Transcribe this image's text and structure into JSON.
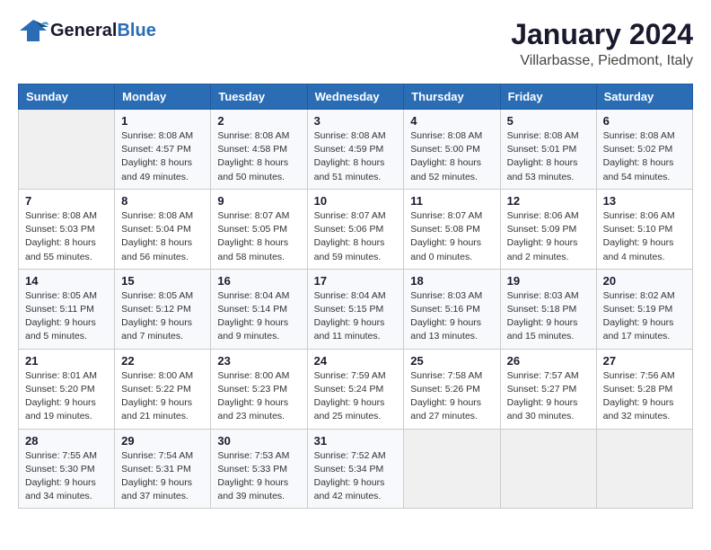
{
  "header": {
    "logo_general": "General",
    "logo_blue": "Blue",
    "month_title": "January 2024",
    "location": "Villarbasse, Piedmont, Italy"
  },
  "days_of_week": [
    "Sunday",
    "Monday",
    "Tuesday",
    "Wednesday",
    "Thursday",
    "Friday",
    "Saturday"
  ],
  "weeks": [
    [
      {
        "day": "",
        "info": ""
      },
      {
        "day": "1",
        "info": "Sunrise: 8:08 AM\nSunset: 4:57 PM\nDaylight: 8 hours\nand 49 minutes."
      },
      {
        "day": "2",
        "info": "Sunrise: 8:08 AM\nSunset: 4:58 PM\nDaylight: 8 hours\nand 50 minutes."
      },
      {
        "day": "3",
        "info": "Sunrise: 8:08 AM\nSunset: 4:59 PM\nDaylight: 8 hours\nand 51 minutes."
      },
      {
        "day": "4",
        "info": "Sunrise: 8:08 AM\nSunset: 5:00 PM\nDaylight: 8 hours\nand 52 minutes."
      },
      {
        "day": "5",
        "info": "Sunrise: 8:08 AM\nSunset: 5:01 PM\nDaylight: 8 hours\nand 53 minutes."
      },
      {
        "day": "6",
        "info": "Sunrise: 8:08 AM\nSunset: 5:02 PM\nDaylight: 8 hours\nand 54 minutes."
      }
    ],
    [
      {
        "day": "7",
        "info": "Sunrise: 8:08 AM\nSunset: 5:03 PM\nDaylight: 8 hours\nand 55 minutes."
      },
      {
        "day": "8",
        "info": "Sunrise: 8:08 AM\nSunset: 5:04 PM\nDaylight: 8 hours\nand 56 minutes."
      },
      {
        "day": "9",
        "info": "Sunrise: 8:07 AM\nSunset: 5:05 PM\nDaylight: 8 hours\nand 58 minutes."
      },
      {
        "day": "10",
        "info": "Sunrise: 8:07 AM\nSunset: 5:06 PM\nDaylight: 8 hours\nand 59 minutes."
      },
      {
        "day": "11",
        "info": "Sunrise: 8:07 AM\nSunset: 5:08 PM\nDaylight: 9 hours\nand 0 minutes."
      },
      {
        "day": "12",
        "info": "Sunrise: 8:06 AM\nSunset: 5:09 PM\nDaylight: 9 hours\nand 2 minutes."
      },
      {
        "day": "13",
        "info": "Sunrise: 8:06 AM\nSunset: 5:10 PM\nDaylight: 9 hours\nand 4 minutes."
      }
    ],
    [
      {
        "day": "14",
        "info": "Sunrise: 8:05 AM\nSunset: 5:11 PM\nDaylight: 9 hours\nand 5 minutes."
      },
      {
        "day": "15",
        "info": "Sunrise: 8:05 AM\nSunset: 5:12 PM\nDaylight: 9 hours\nand 7 minutes."
      },
      {
        "day": "16",
        "info": "Sunrise: 8:04 AM\nSunset: 5:14 PM\nDaylight: 9 hours\nand 9 minutes."
      },
      {
        "day": "17",
        "info": "Sunrise: 8:04 AM\nSunset: 5:15 PM\nDaylight: 9 hours\nand 11 minutes."
      },
      {
        "day": "18",
        "info": "Sunrise: 8:03 AM\nSunset: 5:16 PM\nDaylight: 9 hours\nand 13 minutes."
      },
      {
        "day": "19",
        "info": "Sunrise: 8:03 AM\nSunset: 5:18 PM\nDaylight: 9 hours\nand 15 minutes."
      },
      {
        "day": "20",
        "info": "Sunrise: 8:02 AM\nSunset: 5:19 PM\nDaylight: 9 hours\nand 17 minutes."
      }
    ],
    [
      {
        "day": "21",
        "info": "Sunrise: 8:01 AM\nSunset: 5:20 PM\nDaylight: 9 hours\nand 19 minutes."
      },
      {
        "day": "22",
        "info": "Sunrise: 8:00 AM\nSunset: 5:22 PM\nDaylight: 9 hours\nand 21 minutes."
      },
      {
        "day": "23",
        "info": "Sunrise: 8:00 AM\nSunset: 5:23 PM\nDaylight: 9 hours\nand 23 minutes."
      },
      {
        "day": "24",
        "info": "Sunrise: 7:59 AM\nSunset: 5:24 PM\nDaylight: 9 hours\nand 25 minutes."
      },
      {
        "day": "25",
        "info": "Sunrise: 7:58 AM\nSunset: 5:26 PM\nDaylight: 9 hours\nand 27 minutes."
      },
      {
        "day": "26",
        "info": "Sunrise: 7:57 AM\nSunset: 5:27 PM\nDaylight: 9 hours\nand 30 minutes."
      },
      {
        "day": "27",
        "info": "Sunrise: 7:56 AM\nSunset: 5:28 PM\nDaylight: 9 hours\nand 32 minutes."
      }
    ],
    [
      {
        "day": "28",
        "info": "Sunrise: 7:55 AM\nSunset: 5:30 PM\nDaylight: 9 hours\nand 34 minutes."
      },
      {
        "day": "29",
        "info": "Sunrise: 7:54 AM\nSunset: 5:31 PM\nDaylight: 9 hours\nand 37 minutes."
      },
      {
        "day": "30",
        "info": "Sunrise: 7:53 AM\nSunset: 5:33 PM\nDaylight: 9 hours\nand 39 minutes."
      },
      {
        "day": "31",
        "info": "Sunrise: 7:52 AM\nSunset: 5:34 PM\nDaylight: 9 hours\nand 42 minutes."
      },
      {
        "day": "",
        "info": ""
      },
      {
        "day": "",
        "info": ""
      },
      {
        "day": "",
        "info": ""
      }
    ]
  ]
}
